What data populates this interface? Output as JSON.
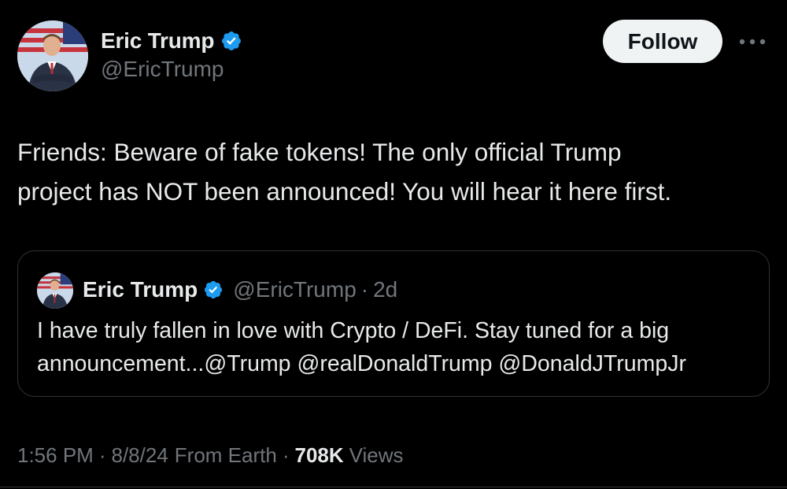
{
  "author": {
    "display_name": "Eric Trump",
    "handle": "@EricTrump",
    "verified": true
  },
  "actions": {
    "follow_label": "Follow",
    "more_icon": "more-horizontal-icon"
  },
  "tweet": {
    "text": "Friends: Beware of fake tokens! The only official Trump\nproject has NOT been announced! You will hear it here first."
  },
  "quoted_tweet": {
    "display_name": "Eric Trump",
    "handle": "@EricTrump",
    "separator": "·",
    "time": "2d",
    "text": "I have truly fallen in love with Crypto / DeFi. Stay tuned for a big\nannouncement...@Trump @realDonaldTrump @DonaldJTrumpJr"
  },
  "meta": {
    "time": "1:56 PM",
    "date": "8/8/24",
    "source": "From Earth",
    "separator": "·",
    "views_count": "708K",
    "views_label": "Views"
  },
  "colors": {
    "background": "#000000",
    "primary_text": "#e7e9ea",
    "secondary_text": "#71767b",
    "verified_badge": "#1d9bf0",
    "border": "#2f3336",
    "follow_button_bg": "#eff3f4"
  }
}
